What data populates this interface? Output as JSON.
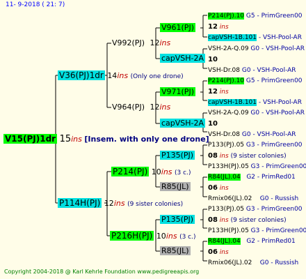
{
  "header": "11-  9-2018 ( 21:  7)",
  "footer": "Copyright 2004-2018 @ Karl Kehrle Foundation   www.pedigreeapis.org",
  "root": {
    "name": "V15(PJ)1dr",
    "num": "15",
    "ins": "ins",
    "note": "[Insem. with only one drone]"
  },
  "sire": {
    "name": "V36(PJ)1dr",
    "num": "14",
    "ins": "ins",
    "note": "(Only one drone)"
  },
  "dam": {
    "name": "P114H(PJ)",
    "num": "12",
    "ins": "ins",
    "note": "(9 sister colonies)"
  },
  "v992": {
    "name": "V992(PJ)",
    "num": "12",
    "ins": "ins"
  },
  "v964": {
    "name": "V964(PJ)",
    "num": "12",
    "ins": "ins"
  },
  "p214": {
    "name": "P214(PJ)",
    "num": "10",
    "ins": "ins",
    "note": "(3 c.)"
  },
  "p216": {
    "name": "P216H(PJ)",
    "num": "10",
    "ins": "ins",
    "note": "(3 c.)"
  },
  "v961": {
    "name": "V961(PJ)"
  },
  "capa": {
    "name": "capVSH-2A"
  },
  "v971": {
    "name": "V971(PJ)"
  },
  "capb": {
    "name": "capVSH-2A"
  },
  "p135a": {
    "name": "P135(PJ)"
  },
  "r85a": {
    "name": "R85(JL)"
  },
  "p135b": {
    "name": "P135(PJ)"
  },
  "r85b": {
    "name": "R85(JL)"
  },
  "g1": {
    "a": "P214(PJ).10",
    "ag": "G5 - PrimGreen00",
    "num": "12",
    "ins": "ins",
    "b": "capVSH-1B.101",
    "bg": "- VSH-Pool-AR"
  },
  "g2": {
    "a": "VSH-2A-Q.09",
    "ag": "G0 - VSH-Pool-AR",
    "num": "10",
    "b": "VSH-Dr.08",
    "bg": "G0 - VSH-Pool-AR"
  },
  "g3": {
    "a": "P214(PJ).10",
    "ag": "G5 - PrimGreen00",
    "num": "12",
    "ins": "ins",
    "b": "capVSH-1B.101",
    "bg": "- VSH-Pool-AR"
  },
  "g4": {
    "a": "VSH-2A-Q.09",
    "ag": "G0 - VSH-Pool-AR",
    "num": "10",
    "b": "VSH-Dr.08",
    "bg": "G0 - VSH-Pool-AR"
  },
  "g5": {
    "a": "P133(PJ).05",
    "ag": "G3 - PrimGreen00",
    "num": "08",
    "ins": "ins",
    "note": "(9 sister colonies)",
    "b": "P133H(PJ).05",
    "bg": "G3 - PrimGreen00"
  },
  "g6": {
    "a": "R84(JL).04",
    "ag": "G2 - PrimRed01",
    "num": "06",
    "ins": "ins",
    "b": "Rmix06(JL).02",
    "bg": "G0 - Russish"
  },
  "g7": {
    "a": "P133(PJ).05",
    "ag": "G3 - PrimGreen00",
    "num": "08",
    "ins": "ins",
    "note": "(9 sister colonies)",
    "b": "P133H(PJ).05",
    "bg": "G3 - PrimGreen00"
  },
  "g8": {
    "a": "R84(JL).04",
    "ag": "G2 - PrimRed01",
    "num": "06",
    "ins": "ins",
    "b": "Rmix06(JL).02",
    "bg": "G0 - Russish"
  }
}
